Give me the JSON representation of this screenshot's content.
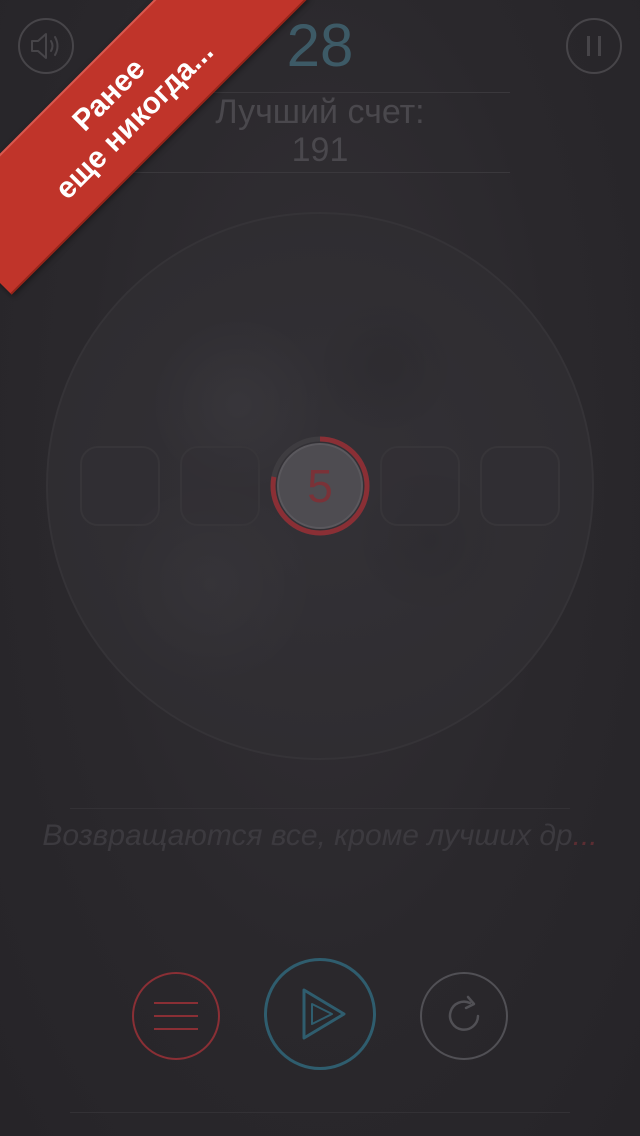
{
  "header": {
    "score": "28",
    "best_label": "Лучший счет:",
    "best_value": "191"
  },
  "game": {
    "timer_value": "5",
    "timer_progress": 0.22
  },
  "quote": {
    "text": "Возвращаются все, кроме лучших др",
    "ellipsis": "..."
  },
  "promo_banner": {
    "line1": "Ранее",
    "line2": "еще никогда..."
  },
  "controls": {
    "sound": "speaker-icon",
    "pause": "pause-icon",
    "menu": "menu-icon",
    "play": "play-icon",
    "replay": "replay-icon"
  },
  "colors": {
    "background": "#2b292d",
    "score": "#3d5a66",
    "accent_red": "#8a2f35",
    "accent_teal": "#2f5d6e",
    "banner": "#c0342a"
  }
}
